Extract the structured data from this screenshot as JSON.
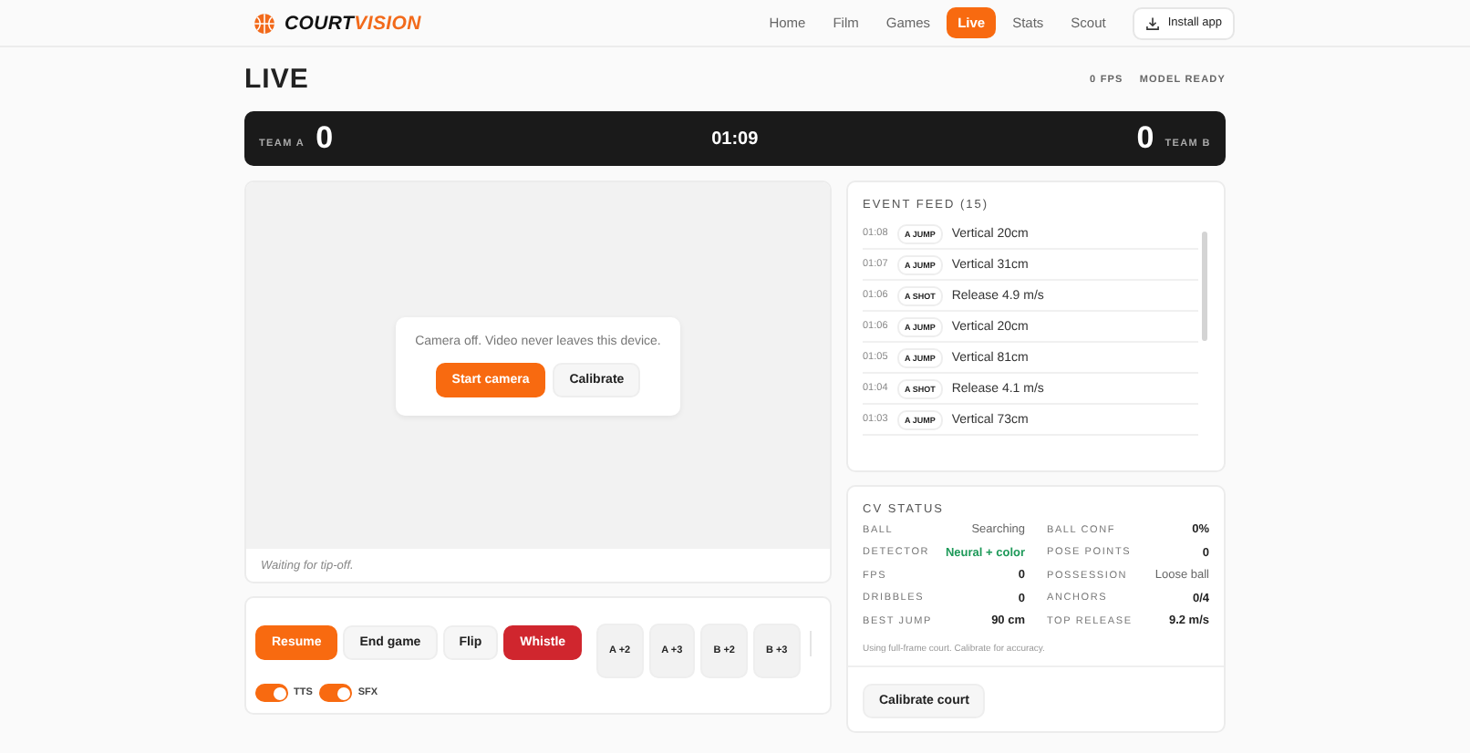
{
  "brand": {
    "part1": "COURT",
    "part2": "VISION"
  },
  "nav": [
    {
      "label": "Home",
      "selected": false
    },
    {
      "label": "Film",
      "selected": false
    },
    {
      "label": "Games",
      "selected": false
    },
    {
      "label": "Live",
      "selected": true
    },
    {
      "label": "Stats",
      "selected": false
    },
    {
      "label": "Scout",
      "selected": false
    }
  ],
  "install_button": "Install app",
  "page_title": "LIVE",
  "status_tags": [
    "0 FPS",
    "MODEL READY"
  ],
  "scoreboard": {
    "team_a": "TEAM A",
    "score_a": "0",
    "clock": "01:09",
    "score_b": "0",
    "team_b": "TEAM B"
  },
  "camera": {
    "message": "Camera off. Video never leaves this device.",
    "start_button": "Start camera",
    "calibrate_button": "Calibrate",
    "caption": "Waiting for tip-off."
  },
  "controls": [
    {
      "label": "Resume",
      "kind": "primary"
    },
    {
      "label": "End game",
      "kind": "plain"
    },
    {
      "label": "Flip",
      "kind": "plain"
    },
    {
      "label": "Whistle",
      "kind": "danger"
    },
    {
      "label": "A +2",
      "kind": "score"
    },
    {
      "label": "A +3",
      "kind": "score"
    },
    {
      "label": "B +2",
      "kind": "score"
    },
    {
      "label": "B +3",
      "kind": "score"
    }
  ],
  "toggles": [
    {
      "label": "TTS",
      "on": true
    },
    {
      "label": "SFX",
      "on": true
    }
  ],
  "event_feed": {
    "title": "EVENT FEED (15)",
    "events": [
      {
        "time": "01:08",
        "tag": "A JUMP",
        "text": "Vertical 20cm"
      },
      {
        "time": "01:07",
        "tag": "A JUMP",
        "text": "Vertical 31cm"
      },
      {
        "time": "01:06",
        "tag": "A SHOT",
        "text": "Release 4.9 m/s"
      },
      {
        "time": "01:06",
        "tag": "A JUMP",
        "text": "Vertical 20cm"
      },
      {
        "time": "01:05",
        "tag": "A JUMP",
        "text": "Vertical 81cm"
      },
      {
        "time": "01:04",
        "tag": "A SHOT",
        "text": "Release 4.1 m/s"
      },
      {
        "time": "01:03",
        "tag": "A JUMP",
        "text": "Vertical 73cm"
      }
    ]
  },
  "cv_status": {
    "title": "CV STATUS",
    "stats": [
      {
        "label": "BALL",
        "value": "Searching",
        "kind": "muted"
      },
      {
        "label": "BALL CONF",
        "value": "0%",
        "kind": "strong"
      },
      {
        "label": "DETECTOR",
        "value": "Neural + color",
        "kind": "good"
      },
      {
        "label": "POSE POINTS",
        "value": "0",
        "kind": "strong"
      },
      {
        "label": "FPS",
        "value": "0",
        "kind": "strong"
      },
      {
        "label": "POSSESSION",
        "value": "Loose ball",
        "kind": "muted"
      },
      {
        "label": "DRIBBLES",
        "value": "0",
        "kind": "strong"
      },
      {
        "label": "ANCHORS",
        "value": "0/4",
        "kind": "strong"
      },
      {
        "label": "BEST JUMP",
        "value": "90 cm",
        "kind": "strong"
      },
      {
        "label": "TOP RELEASE",
        "value": "9.2 m/s",
        "kind": "strong"
      }
    ],
    "note": "Using full-frame court. Calibrate for accuracy.",
    "calibrate_button": "Calibrate court"
  }
}
